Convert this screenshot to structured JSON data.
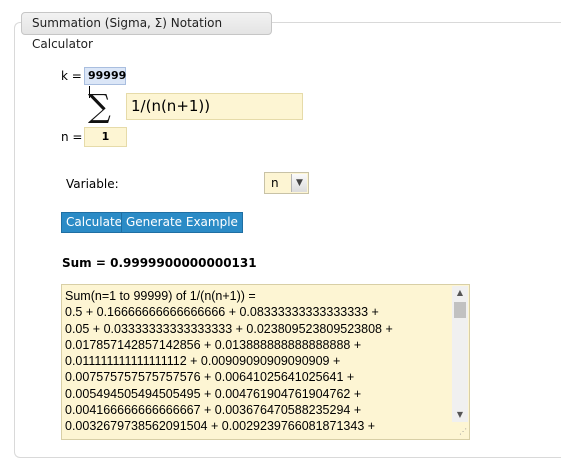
{
  "tab": {
    "title": "Summation (Sigma, Σ) Notation Calculator"
  },
  "form": {
    "k_label": "k =",
    "k_value": "99999",
    "sigma_symbol": "∑",
    "expression": "1/(n(n+1))",
    "n_label": "n =",
    "n_value": "1",
    "variable_label": "Variable:",
    "variable_value": "n"
  },
  "buttons": {
    "calculate": "Calculate",
    "generate_example": "Generate Example"
  },
  "result": {
    "sum_text": "Sum = 0.9999900000000131",
    "lines": [
      "Sum(n=1 to 99999) of 1/(n(n+1)) =",
      "0.5 + 0.16666666666666666 + 0.08333333333333333 +",
      "0.05 + 0.03333333333333333 + 0.023809523809523808 +",
      "0.017857142857142856 + 0.013888888888888888 +",
      "0.011111111111111112 + 0.00909090909090909 +",
      "0.007575757575757576 + 0.00641025641025641 +",
      "0.005494505494505495 + 0.004761904761904762 +",
      "0.004166666666666667 + 0.003676470588235294 +",
      "0.0032679738562091504 + 0.0029239766081871343 +"
    ]
  },
  "icons": {
    "dropdown": "chevron-down-icon",
    "scroll_up": "scroll-up-icon",
    "scroll_down": "scroll-down-icon",
    "resize": "resize-grip-icon"
  },
  "colors": {
    "input_bg": "#fdf5d3",
    "k_input_bg": "#dbe6f7",
    "button_bg": "#2b8bc6"
  }
}
